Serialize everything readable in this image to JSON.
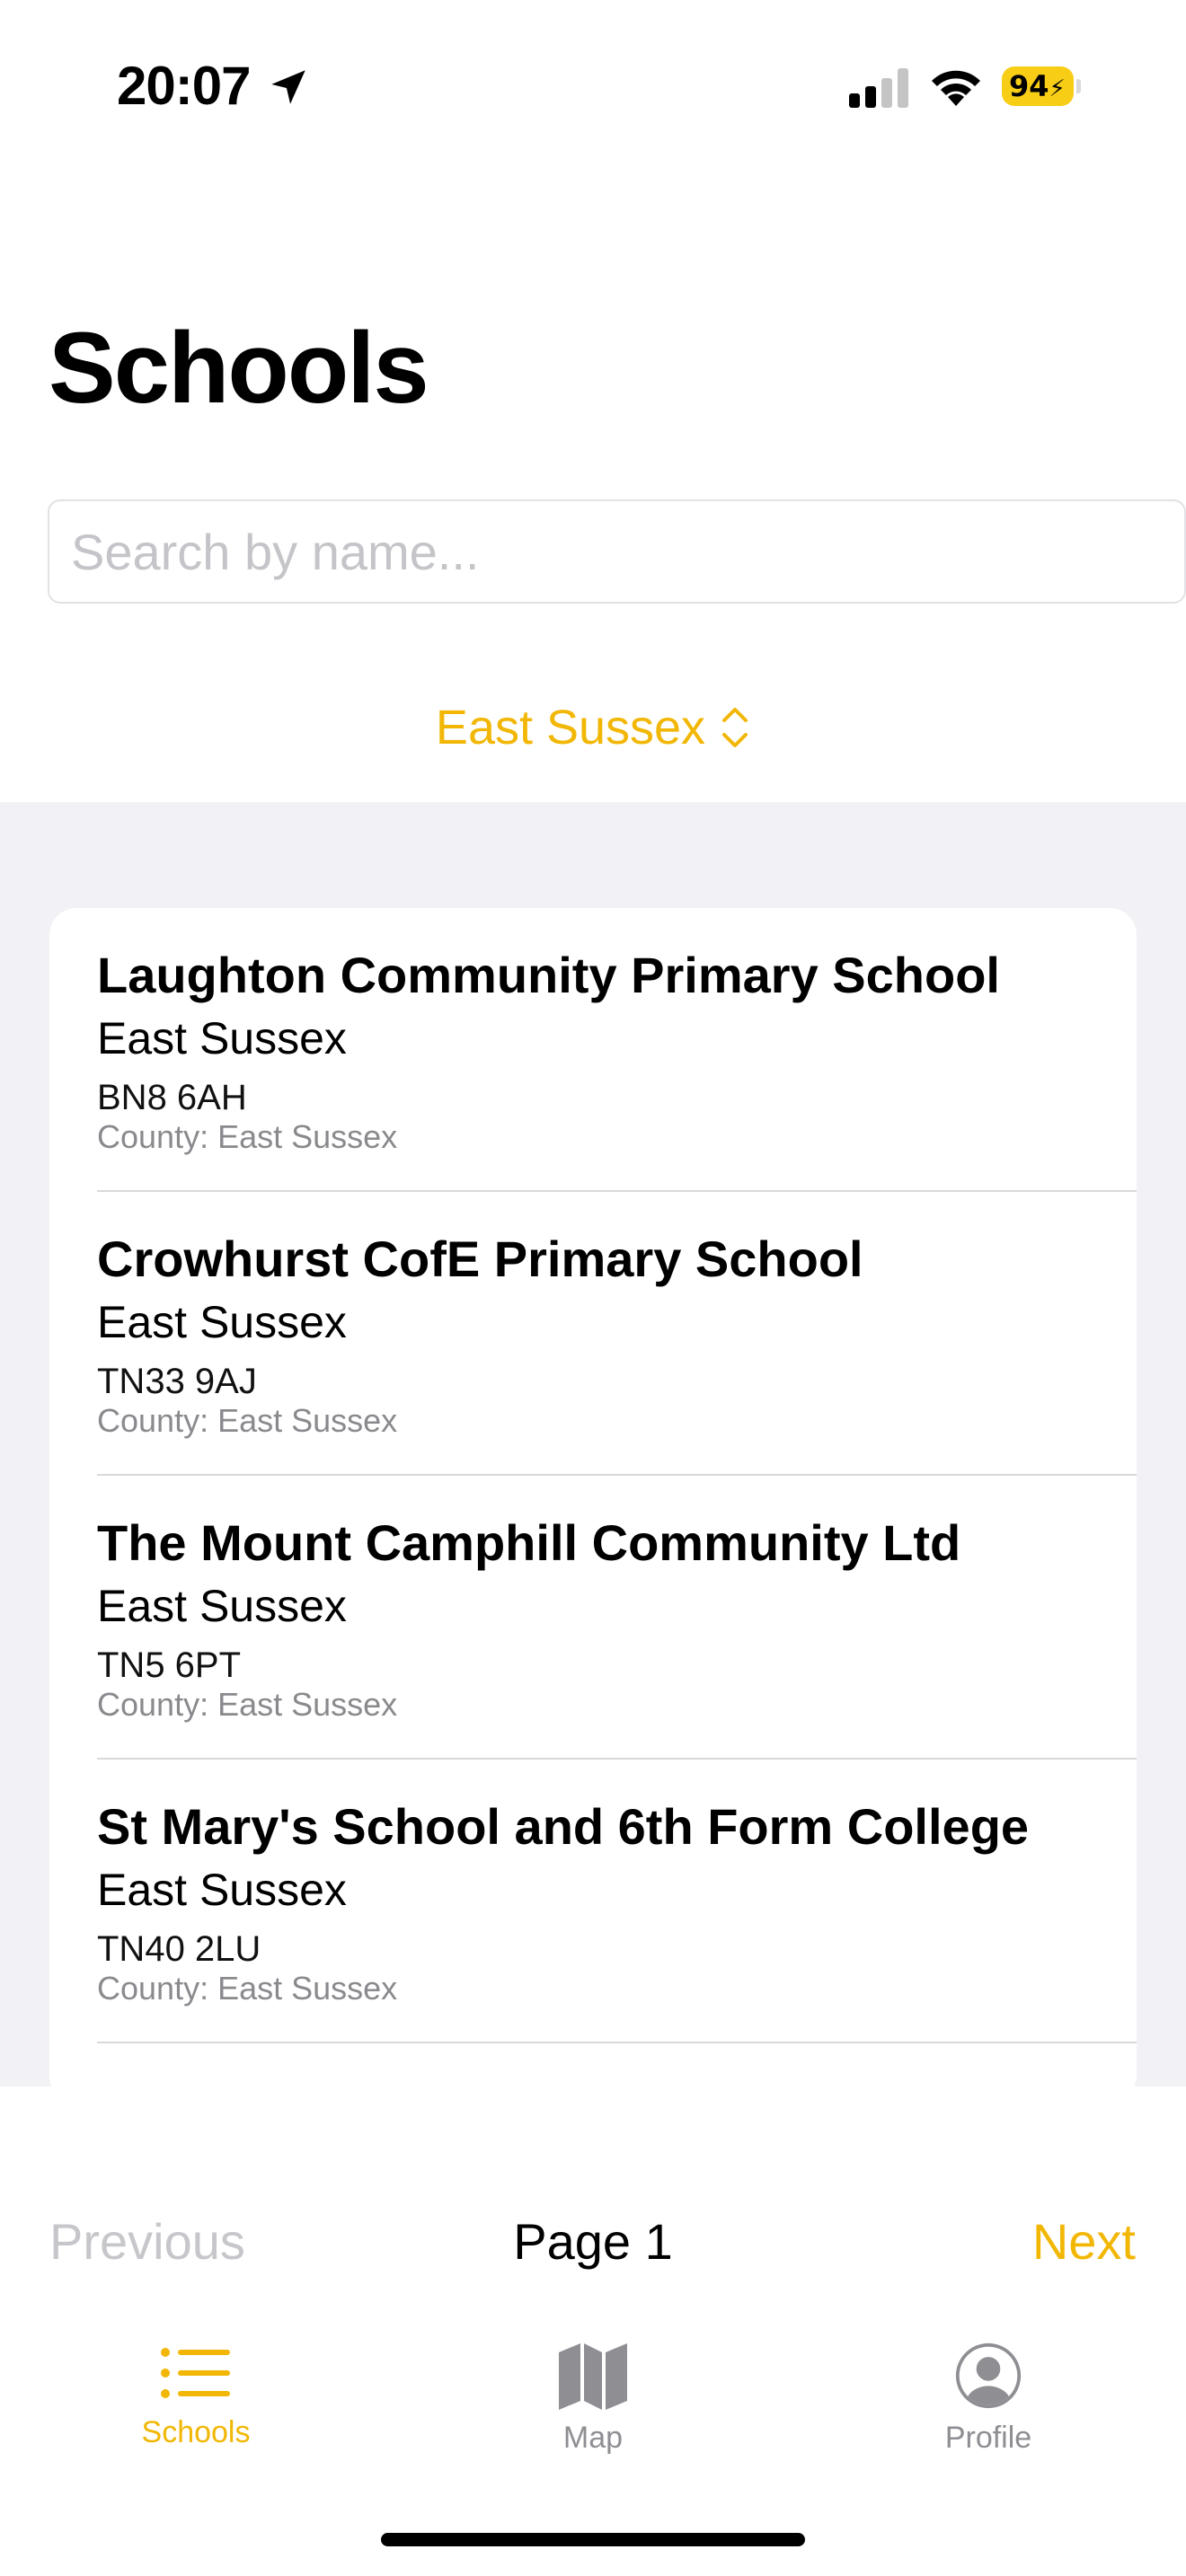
{
  "status_bar": {
    "time": "20:07",
    "battery": "94"
  },
  "header": {
    "title": "Schools"
  },
  "search": {
    "placeholder": "Search by name...",
    "value": ""
  },
  "filter": {
    "county": "East Sussex"
  },
  "schools": [
    {
      "name": "Laughton Community Primary School",
      "region": "East Sussex",
      "postcode": "BN8 6AH",
      "county": "County: East Sussex"
    },
    {
      "name": "Crowhurst CofE Primary School",
      "region": "East Sussex",
      "postcode": "TN33 9AJ",
      "county": "County: East Sussex"
    },
    {
      "name": "The Mount Camphill Community Ltd",
      "region": "East Sussex",
      "postcode": "TN5 6PT",
      "county": "County: East Sussex"
    },
    {
      "name": "St Mary's School and 6th Form College",
      "region": "East Sussex",
      "postcode": "TN40 2LU",
      "county": "County: East Sussex"
    }
  ],
  "pagination": {
    "previous": "Previous",
    "page": "Page 1",
    "next": "Next"
  },
  "tabs": [
    {
      "label": "Schools",
      "icon": "list-icon",
      "active": true
    },
    {
      "label": "Map",
      "icon": "map-icon",
      "active": false
    },
    {
      "label": "Profile",
      "icon": "profile-icon",
      "active": false
    }
  ],
  "colors": {
    "accent": "#f2b705",
    "list_background": "#f2f2f6",
    "inactive": "#8e8e93"
  }
}
